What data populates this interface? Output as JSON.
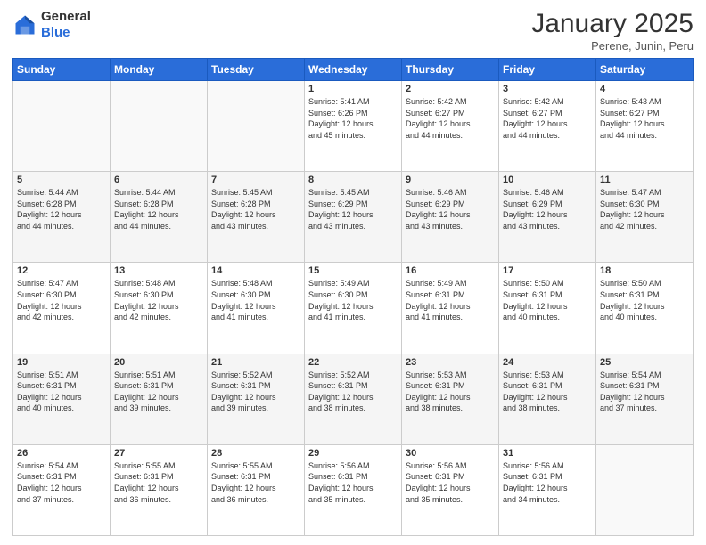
{
  "logo": {
    "general": "General",
    "blue": "Blue"
  },
  "header": {
    "title": "January 2025",
    "subtitle": "Perene, Junin, Peru"
  },
  "weekdays": [
    "Sunday",
    "Monday",
    "Tuesday",
    "Wednesday",
    "Thursday",
    "Friday",
    "Saturday"
  ],
  "weeks": [
    [
      {
        "day": "",
        "info": ""
      },
      {
        "day": "",
        "info": ""
      },
      {
        "day": "",
        "info": ""
      },
      {
        "day": "1",
        "info": "Sunrise: 5:41 AM\nSunset: 6:26 PM\nDaylight: 12 hours\nand 45 minutes."
      },
      {
        "day": "2",
        "info": "Sunrise: 5:42 AM\nSunset: 6:27 PM\nDaylight: 12 hours\nand 44 minutes."
      },
      {
        "day": "3",
        "info": "Sunrise: 5:42 AM\nSunset: 6:27 PM\nDaylight: 12 hours\nand 44 minutes."
      },
      {
        "day": "4",
        "info": "Sunrise: 5:43 AM\nSunset: 6:27 PM\nDaylight: 12 hours\nand 44 minutes."
      }
    ],
    [
      {
        "day": "5",
        "info": "Sunrise: 5:44 AM\nSunset: 6:28 PM\nDaylight: 12 hours\nand 44 minutes."
      },
      {
        "day": "6",
        "info": "Sunrise: 5:44 AM\nSunset: 6:28 PM\nDaylight: 12 hours\nand 44 minutes."
      },
      {
        "day": "7",
        "info": "Sunrise: 5:45 AM\nSunset: 6:28 PM\nDaylight: 12 hours\nand 43 minutes."
      },
      {
        "day": "8",
        "info": "Sunrise: 5:45 AM\nSunset: 6:29 PM\nDaylight: 12 hours\nand 43 minutes."
      },
      {
        "day": "9",
        "info": "Sunrise: 5:46 AM\nSunset: 6:29 PM\nDaylight: 12 hours\nand 43 minutes."
      },
      {
        "day": "10",
        "info": "Sunrise: 5:46 AM\nSunset: 6:29 PM\nDaylight: 12 hours\nand 43 minutes."
      },
      {
        "day": "11",
        "info": "Sunrise: 5:47 AM\nSunset: 6:30 PM\nDaylight: 12 hours\nand 42 minutes."
      }
    ],
    [
      {
        "day": "12",
        "info": "Sunrise: 5:47 AM\nSunset: 6:30 PM\nDaylight: 12 hours\nand 42 minutes."
      },
      {
        "day": "13",
        "info": "Sunrise: 5:48 AM\nSunset: 6:30 PM\nDaylight: 12 hours\nand 42 minutes."
      },
      {
        "day": "14",
        "info": "Sunrise: 5:48 AM\nSunset: 6:30 PM\nDaylight: 12 hours\nand 41 minutes."
      },
      {
        "day": "15",
        "info": "Sunrise: 5:49 AM\nSunset: 6:30 PM\nDaylight: 12 hours\nand 41 minutes."
      },
      {
        "day": "16",
        "info": "Sunrise: 5:49 AM\nSunset: 6:31 PM\nDaylight: 12 hours\nand 41 minutes."
      },
      {
        "day": "17",
        "info": "Sunrise: 5:50 AM\nSunset: 6:31 PM\nDaylight: 12 hours\nand 40 minutes."
      },
      {
        "day": "18",
        "info": "Sunrise: 5:50 AM\nSunset: 6:31 PM\nDaylight: 12 hours\nand 40 minutes."
      }
    ],
    [
      {
        "day": "19",
        "info": "Sunrise: 5:51 AM\nSunset: 6:31 PM\nDaylight: 12 hours\nand 40 minutes."
      },
      {
        "day": "20",
        "info": "Sunrise: 5:51 AM\nSunset: 6:31 PM\nDaylight: 12 hours\nand 39 minutes."
      },
      {
        "day": "21",
        "info": "Sunrise: 5:52 AM\nSunset: 6:31 PM\nDaylight: 12 hours\nand 39 minutes."
      },
      {
        "day": "22",
        "info": "Sunrise: 5:52 AM\nSunset: 6:31 PM\nDaylight: 12 hours\nand 38 minutes."
      },
      {
        "day": "23",
        "info": "Sunrise: 5:53 AM\nSunset: 6:31 PM\nDaylight: 12 hours\nand 38 minutes."
      },
      {
        "day": "24",
        "info": "Sunrise: 5:53 AM\nSunset: 6:31 PM\nDaylight: 12 hours\nand 38 minutes."
      },
      {
        "day": "25",
        "info": "Sunrise: 5:54 AM\nSunset: 6:31 PM\nDaylight: 12 hours\nand 37 minutes."
      }
    ],
    [
      {
        "day": "26",
        "info": "Sunrise: 5:54 AM\nSunset: 6:31 PM\nDaylight: 12 hours\nand 37 minutes."
      },
      {
        "day": "27",
        "info": "Sunrise: 5:55 AM\nSunset: 6:31 PM\nDaylight: 12 hours\nand 36 minutes."
      },
      {
        "day": "28",
        "info": "Sunrise: 5:55 AM\nSunset: 6:31 PM\nDaylight: 12 hours\nand 36 minutes."
      },
      {
        "day": "29",
        "info": "Sunrise: 5:56 AM\nSunset: 6:31 PM\nDaylight: 12 hours\nand 35 minutes."
      },
      {
        "day": "30",
        "info": "Sunrise: 5:56 AM\nSunset: 6:31 PM\nDaylight: 12 hours\nand 35 minutes."
      },
      {
        "day": "31",
        "info": "Sunrise: 5:56 AM\nSunset: 6:31 PM\nDaylight: 12 hours\nand 34 minutes."
      },
      {
        "day": "",
        "info": ""
      }
    ]
  ]
}
